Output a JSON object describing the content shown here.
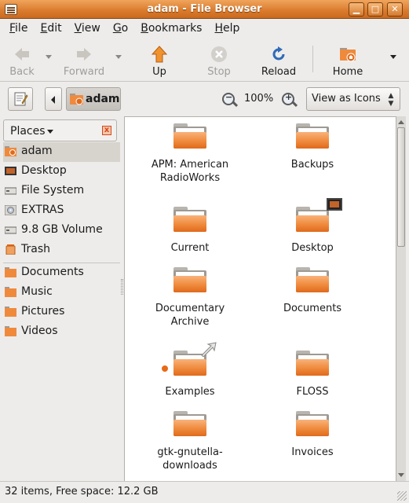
{
  "window": {
    "title": "adam - File Browser",
    "min_glyph": "▁",
    "max_glyph": "□",
    "close_glyph": "✕"
  },
  "menubar": {
    "items": [
      {
        "accel": "F",
        "rest": "ile"
      },
      {
        "accel": "E",
        "rest": "dit"
      },
      {
        "accel": "V",
        "rest": "iew"
      },
      {
        "accel": "G",
        "rest": "o"
      },
      {
        "accel": "B",
        "rest": "ookmarks"
      },
      {
        "accel": "H",
        "rest": "elp"
      }
    ]
  },
  "toolbar": {
    "back_label": "Back",
    "forward_label": "Forward",
    "up_label": "Up",
    "stop_label": "Stop",
    "reload_label": "Reload",
    "home_label": "Home",
    "overflow_icon": "chevron-down-icon"
  },
  "location": {
    "crumb_label": "adam",
    "zoom_level": "100%",
    "zoom_out_glyph": "−",
    "zoom_in_glyph": "+",
    "view_mode": "View as Icons",
    "view_mode_arrows": "▲▼"
  },
  "sidebar": {
    "header": "Places",
    "close_glyph": "x",
    "places": [
      {
        "label": "adam",
        "icon": "home-folder-icon",
        "selected": true
      },
      {
        "label": "Desktop",
        "icon": "desktop-icon"
      },
      {
        "label": "File System",
        "icon": "drive-icon"
      },
      {
        "label": "EXTRAS",
        "icon": "cdrom-icon"
      },
      {
        "label": "9.8 GB Volume",
        "icon": "drive-icon"
      },
      {
        "label": "Trash",
        "icon": "trash-icon"
      }
    ],
    "bookmarks": [
      {
        "label": "Documents",
        "icon": "folder-icon"
      },
      {
        "label": "Music",
        "icon": "folder-icon"
      },
      {
        "label": "Pictures",
        "icon": "folder-icon"
      },
      {
        "label": "Videos",
        "icon": "folder-icon"
      }
    ]
  },
  "files": [
    {
      "line1": "APM: American",
      "line2": "RadioWorks"
    },
    {
      "line1": "Backups",
      "line2": ""
    },
    {
      "line1": "Current",
      "line2": ""
    },
    {
      "line1": "Desktop",
      "line2": "",
      "emblem": "desktop-emblem"
    },
    {
      "line1": "Documentary",
      "line2": "Archive"
    },
    {
      "line1": "Documents",
      "line2": ""
    },
    {
      "line1": "Examples",
      "line2": "",
      "emblem": "symlink-emblem"
    },
    {
      "line1": "FLOSS",
      "line2": ""
    },
    {
      "line1": "gtk-gnutella-",
      "line2": "downloads"
    },
    {
      "line1": "Invoices",
      "line2": ""
    }
  ],
  "statusbar": {
    "text": "32 items, Free space: 12.2 GB"
  },
  "colors": {
    "titlebar": "#d97a2c",
    "folder": "#ef8a3d",
    "selection": "#d7d3cd"
  }
}
